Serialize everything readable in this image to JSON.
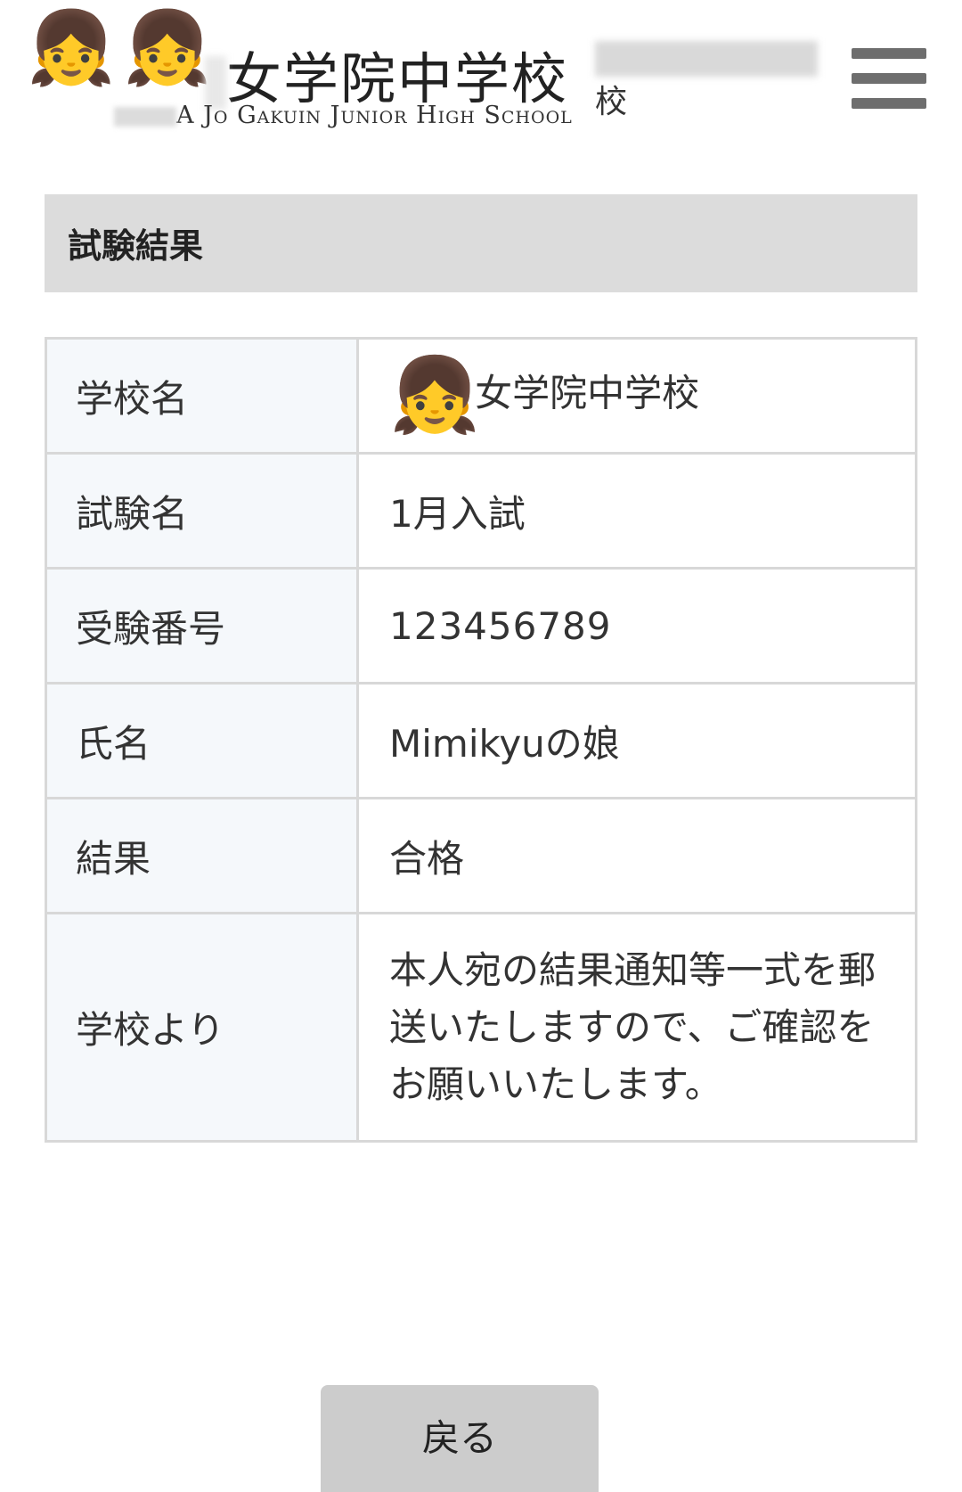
{
  "header": {
    "school_title": "女学院中学校",
    "school_subtitle": "A Jo Gakuin Junior High School",
    "side_note_tail": "校",
    "menu_icon": "hamburger-menu-icon",
    "avatar_emoji": "👧"
  },
  "section": {
    "title": "試験結果"
  },
  "result_table": {
    "rows": [
      {
        "label": "学校名",
        "value": "女学院中学校"
      },
      {
        "label": "試験名",
        "value": "1月入試"
      },
      {
        "label": "受験番号",
        "value": "123456789"
      },
      {
        "label": "氏名",
        "value": "Mimikyuの娘"
      },
      {
        "label": "結果",
        "value": "合格"
      },
      {
        "label": "学校より",
        "value": "本人宛の結果通知等一式を郵送いたしますので、ご確認をお願いいたします。"
      }
    ]
  },
  "back_button": {
    "label": "戻る"
  }
}
